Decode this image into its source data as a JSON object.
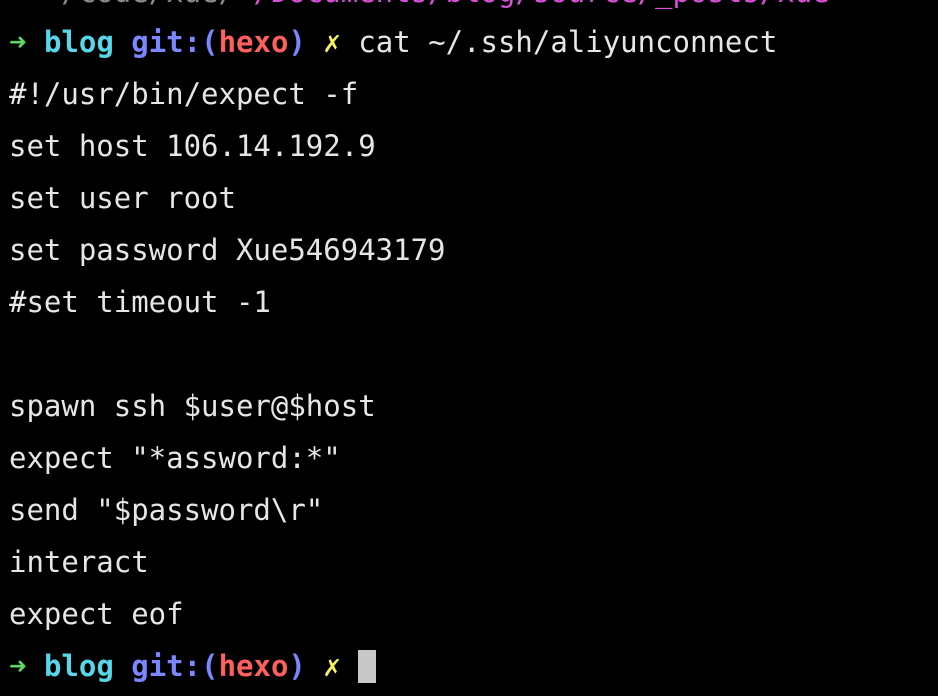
{
  "terminal": {
    "cutoff_line": {
      "prefix": "  ~/code/xue/",
      "path": "~/Documents/blog/source/_posts/xue"
    },
    "prompt1": {
      "arrow": "➜",
      "dir": "blog",
      "git_label": "git:",
      "paren_open": "(",
      "branch": "hexo",
      "paren_close": ")",
      "dirty": "✗",
      "command": "cat ~/.ssh/aliyunconnect"
    },
    "output": [
      "#!/usr/bin/expect -f",
      "set host 106.14.192.9",
      "set user root",
      "set password Xue546943179",
      "#set timeout -1",
      "",
      "spawn ssh $user@$host",
      "expect \"*assword:*\"",
      "send \"$password\\r\"",
      "interact",
      "expect eof"
    ],
    "prompt2": {
      "arrow": "➜",
      "dir": "blog",
      "git_label": "git:",
      "paren_open": "(",
      "branch": "hexo",
      "paren_close": ")",
      "dirty": "✗"
    },
    "colors": {
      "background": "#000000",
      "foreground": "#e6e6e6",
      "arrow": "#5fd75f",
      "dir": "#57d7e8",
      "git": "#7b86ff",
      "branch": "#ff5f5f",
      "dirty": "#f3f35f"
    }
  }
}
